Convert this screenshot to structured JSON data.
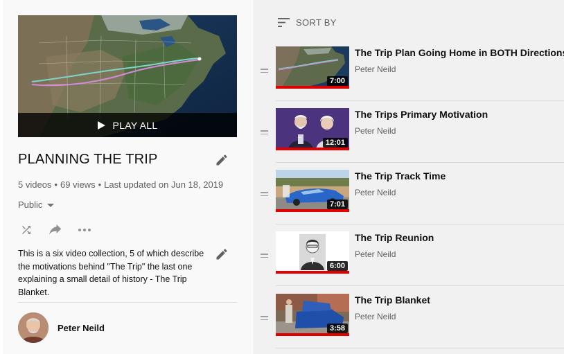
{
  "playlist": {
    "title": "PLANNING THE TRIP",
    "play_all_label": "PLAY ALL",
    "stats": {
      "videos": "5 videos",
      "views": "69 views",
      "updated": "Last updated on Jun 18, 2019"
    },
    "privacy": "Public",
    "description": "This is a six video collection, 5 of which describe the motivations behind \"The Trip\" the last one explaining a small detail of history - The Trip Blanket.",
    "owner": "Peter Neild",
    "actions": [
      "shuffle-icon",
      "share-icon",
      "more-icon"
    ]
  },
  "list": {
    "sort_label": "SORT BY",
    "videos": [
      {
        "title": "The Trip Plan Going Home in BOTH Directions",
        "channel": "Peter Neild",
        "duration": "7:00",
        "progress": 1.0
      },
      {
        "title": "The Trips Primary Motivation",
        "channel": "Peter Neild",
        "duration": "12:01",
        "progress": 1.0
      },
      {
        "title": "The Trip Track Time",
        "channel": "Peter Neild",
        "duration": "7:01",
        "progress": 1.0
      },
      {
        "title": "The Trip Reunion",
        "channel": "Peter Neild",
        "duration": "6:00",
        "progress": 1.0
      },
      {
        "title": "The Trip Blanket",
        "channel": "Peter Neild",
        "duration": "3:58",
        "progress": 1.0
      }
    ]
  },
  "colors": {
    "progress": "#e00000",
    "sidebar_bg": "#f9f9f9",
    "list_bg": "#f1f1f1"
  }
}
